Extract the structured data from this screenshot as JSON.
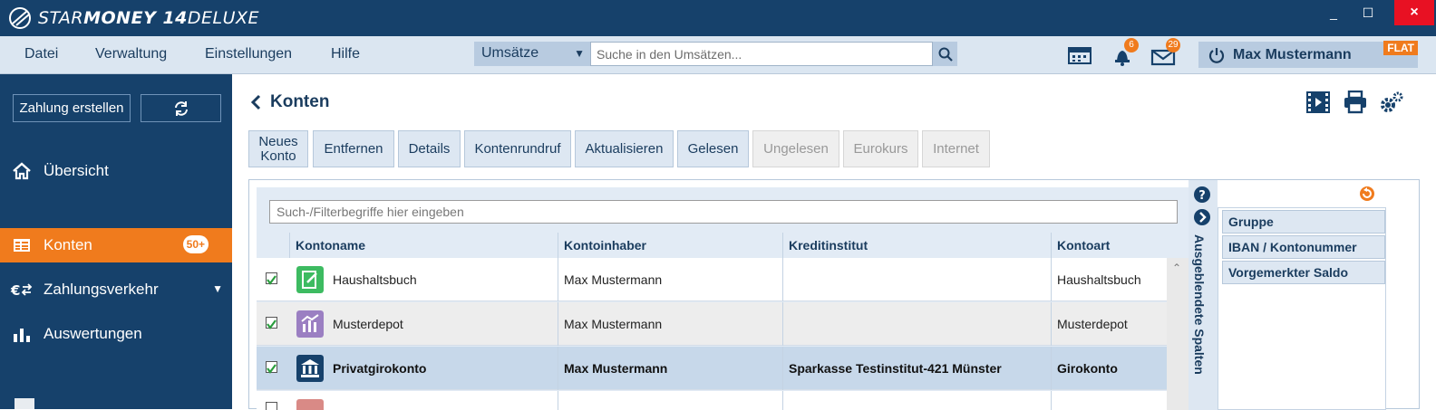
{
  "app": {
    "title_light": "STAR",
    "title_bold": "MONEY 14",
    "title_suffix": " DELUXE",
    "window_min": "_",
    "window_max": "☐",
    "window_close": "×"
  },
  "menu": {
    "items": [
      "Datei",
      "Verwaltung",
      "Einstellungen",
      "Hilfe"
    ]
  },
  "search": {
    "scope": "Umsätze",
    "placeholder": "Suche in den Umsätzen..."
  },
  "topbar": {
    "notifications_count": "6",
    "messages_count": "29",
    "user_name": "Max Mustermann",
    "plan_badge": "FLAT"
  },
  "sidebar": {
    "create_payment": "Zahlung erstellen",
    "nav": [
      {
        "label": "Übersicht",
        "icon": "home-icon"
      },
      {
        "label": "Konten",
        "icon": "accounts-icon",
        "badge": "50+"
      },
      {
        "label": "Zahlungsverkehr",
        "icon": "euro-transfer-icon"
      },
      {
        "label": "Auswertungen",
        "icon": "bar-chart-icon"
      }
    ]
  },
  "page": {
    "title": "Konten"
  },
  "toolbar": {
    "buttons": [
      {
        "label": "Neues Konto",
        "enabled": true
      },
      {
        "label": "Entfernen",
        "enabled": true
      },
      {
        "label": "Details",
        "enabled": true
      },
      {
        "label": "Kontenrundruf",
        "enabled": true
      },
      {
        "label": "Aktualisieren",
        "enabled": true
      },
      {
        "label": "Gelesen",
        "enabled": true
      },
      {
        "label": "Ungelesen",
        "enabled": false
      },
      {
        "label": "Eurokurs",
        "enabled": false
      },
      {
        "label": "Internet",
        "enabled": false
      }
    ]
  },
  "grid": {
    "filter_placeholder": "Such-/Filterbegriffe hier eingeben",
    "columns": [
      "Kontoname",
      "Kontoinhaber",
      "Kreditinstitut",
      "Kontoart"
    ],
    "rows": [
      {
        "name": "Haushaltsbuch",
        "owner": "Max Mustermann",
        "bank": "",
        "type": "Haushaltsbuch",
        "checked": true,
        "selected": false,
        "icon": "household-book-icon",
        "icon_color": "#3dbb61"
      },
      {
        "name": "Musterdepot",
        "owner": "Max Mustermann",
        "bank": "",
        "type": "Musterdepot",
        "checked": true,
        "selected": false,
        "icon": "depot-chart-icon",
        "icon_color": "#9b7fc2"
      },
      {
        "name": "Privatgirokonto",
        "owner": "Max Mustermann",
        "bank": "Sparkasse Testinstitut-421 Münster",
        "type": "Girokonto",
        "checked": true,
        "selected": true,
        "icon": "bank-icon",
        "icon_color": "#16416b"
      }
    ]
  },
  "hidden_columns": {
    "title": "Ausgeblendete Spalten",
    "items": [
      "Gruppe",
      "IBAN / Kontonummer",
      "Vorgemerkter Saldo"
    ]
  },
  "colors": {
    "primary": "#16416b",
    "accent": "#f07b1d",
    "selected_row": "#c7d8ea"
  }
}
